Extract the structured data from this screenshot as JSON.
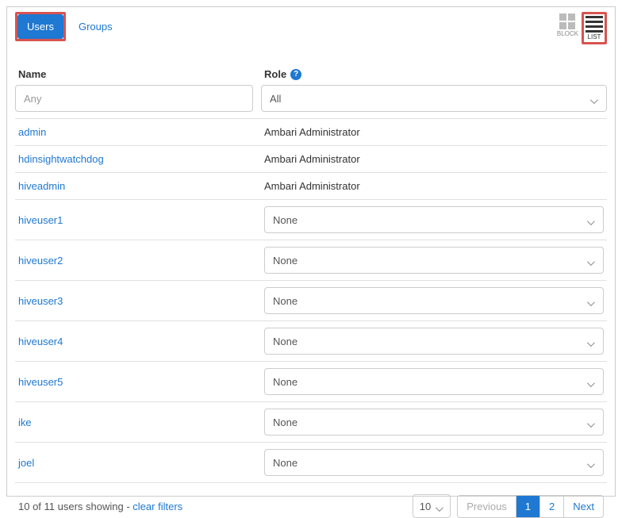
{
  "tabs": {
    "users": "Users",
    "groups": "Groups",
    "active": "users"
  },
  "view": {
    "block_label": "BLOCK",
    "list_label": "LIST",
    "active": "list"
  },
  "columns": {
    "name": "Name",
    "role": "Role"
  },
  "filters": {
    "name_placeholder": "Any",
    "role_selected": "All"
  },
  "rows": [
    {
      "name": "admin",
      "role_text": "Ambari Administrator",
      "editable": false
    },
    {
      "name": "hdinsightwatchdog",
      "role_text": "Ambari Administrator",
      "editable": false
    },
    {
      "name": "hiveadmin",
      "role_text": "Ambari Administrator",
      "editable": false
    },
    {
      "name": "hiveuser1",
      "role_text": "None",
      "editable": true
    },
    {
      "name": "hiveuser2",
      "role_text": "None",
      "editable": true
    },
    {
      "name": "hiveuser3",
      "role_text": "None",
      "editable": true
    },
    {
      "name": "hiveuser4",
      "role_text": "None",
      "editable": true
    },
    {
      "name": "hiveuser5",
      "role_text": "None",
      "editable": true
    },
    {
      "name": "ike",
      "role_text": "None",
      "editable": true
    },
    {
      "name": "joel",
      "role_text": "None",
      "editable": true
    }
  ],
  "footer": {
    "status_prefix": "10 of 11 users showing - ",
    "clear_label": "clear filters",
    "page_size": "10",
    "previous": "Previous",
    "next": "Next",
    "pages": [
      "1",
      "2"
    ],
    "active_page": "1"
  }
}
